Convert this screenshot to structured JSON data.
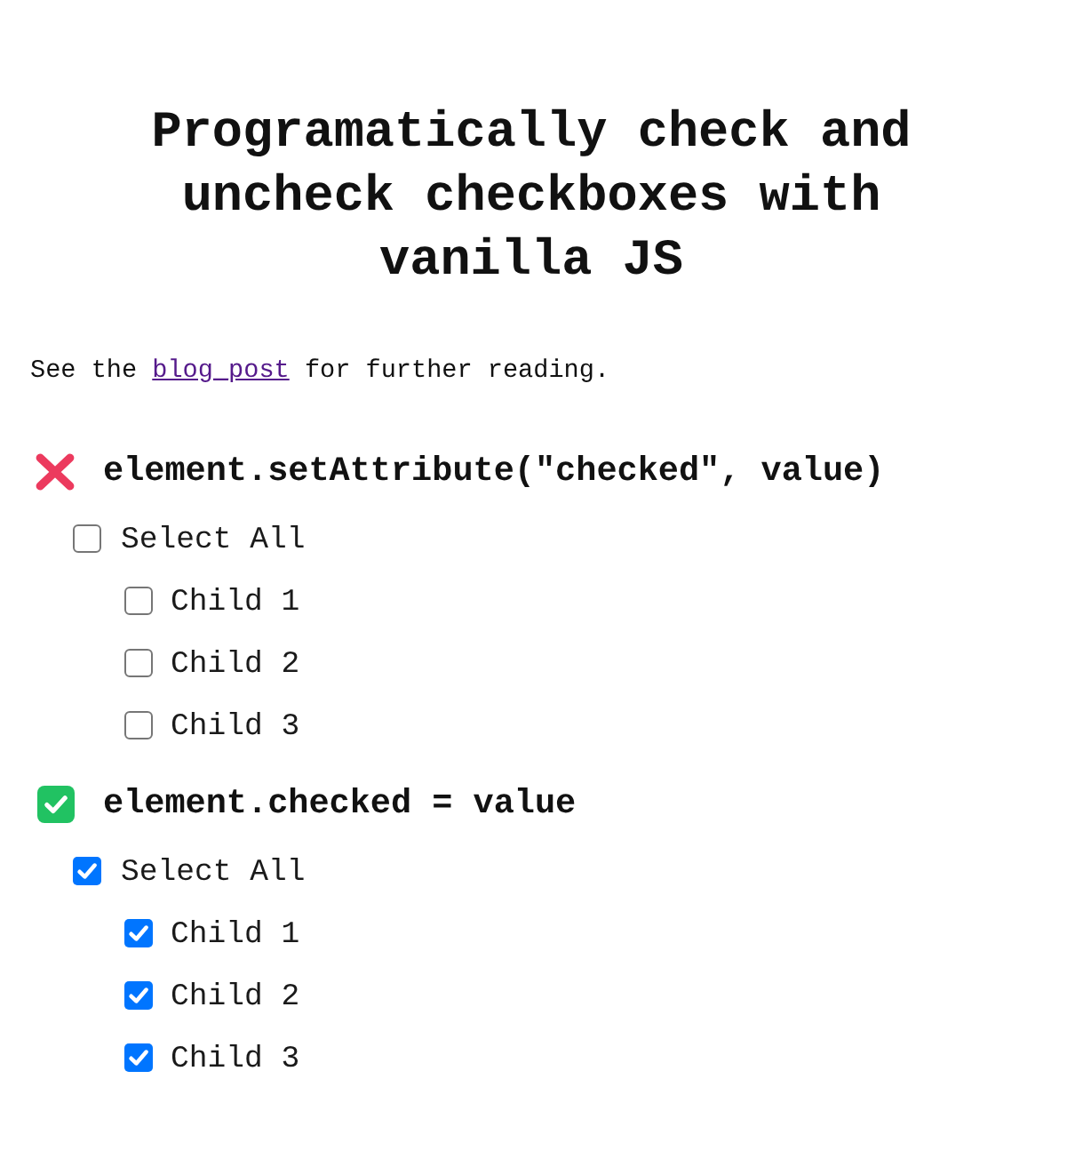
{
  "title": "Programatically check and uncheck checkboxes with vanilla JS",
  "intro": {
    "text_before": "See the",
    "link": "blog_post",
    "text_after": "for further reading."
  },
  "sections": [
    {
      "kind": "fail",
      "heading": "element.setAttribute(\"checked\", value)",
      "checkbox_tree": {
        "label": "Select All",
        "checked": false,
        "children": [
          {
            "label": "Child 1",
            "checked": false
          },
          {
            "label": "Child 2",
            "checked": false
          },
          {
            "label": "Child 3",
            "checked": false
          }
        ]
      }
    },
    {
      "kind": "pass",
      "heading": "element.checked = value",
      "checkbox_tree": {
        "label": "Select All",
        "checked": true,
        "children": [
          {
            "label": "Child 1",
            "checked": true
          },
          {
            "label": "Child 2",
            "checked": true
          },
          {
            "label": "Child 3",
            "checked": true
          }
        ]
      }
    }
  ]
}
